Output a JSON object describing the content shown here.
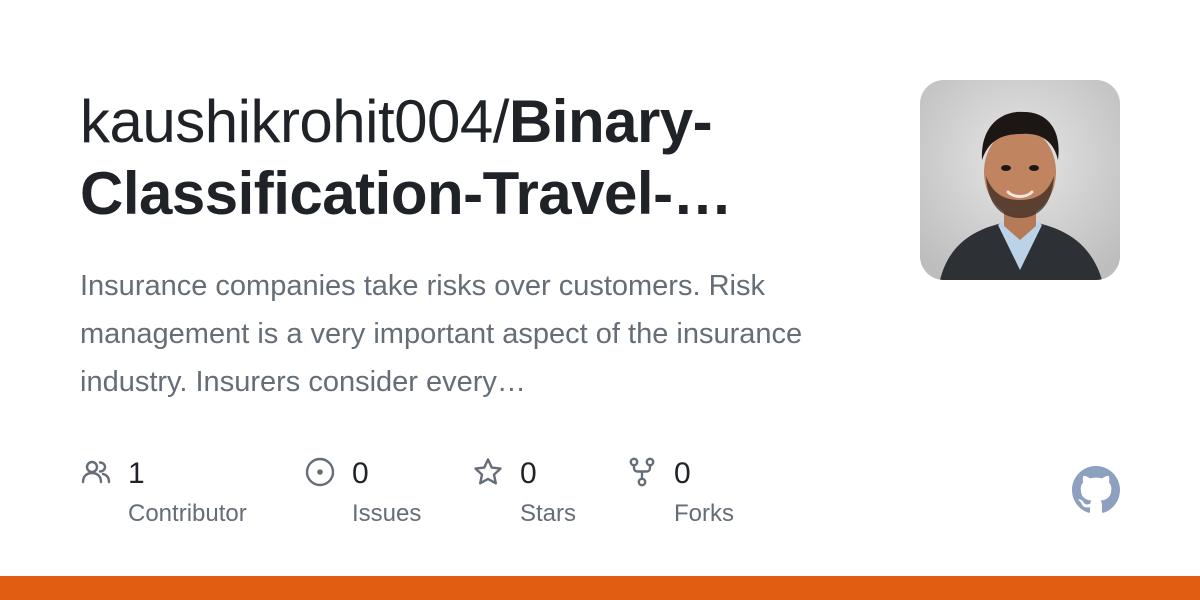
{
  "repo": {
    "owner_prefix": "kaushikrohit004/",
    "name_line1": "Binary-",
    "name_line2": "Classification-Travel-…",
    "description": "Insurance companies take risks over customers. Risk management is a very important aspect of the insurance industry. Insurers consider every…"
  },
  "stats": [
    {
      "icon": "people-icon",
      "count": "1",
      "label": "Contributor"
    },
    {
      "icon": "issue-opened-icon",
      "count": "0",
      "label": "Issues"
    },
    {
      "icon": "star-icon",
      "count": "0",
      "label": "Stars"
    },
    {
      "icon": "repo-forked-icon",
      "count": "0",
      "label": "Forks"
    }
  ],
  "avatar": {
    "icon": "owner-avatar"
  },
  "logo": {
    "icon": "github-mark-icon"
  },
  "colors": {
    "language_bar": "#e05d12",
    "title": "#1f2328",
    "muted": "#656d76",
    "logo": "#8ea0bf"
  }
}
